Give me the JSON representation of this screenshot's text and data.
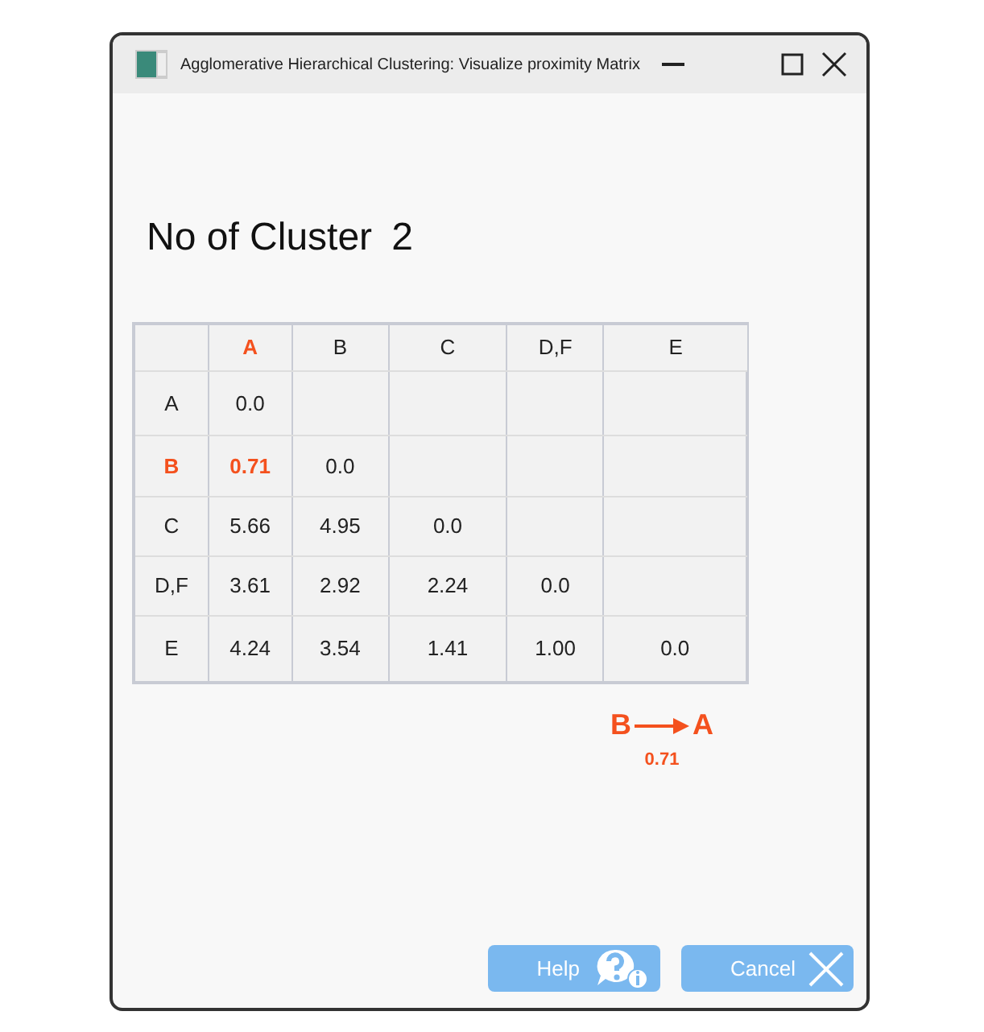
{
  "window": {
    "title": "Agglomerative Hierarchical Clustering: Visualize proximity Matrix"
  },
  "cluster_count": {
    "label": "No of Cluster",
    "value": "2"
  },
  "matrix": {
    "columns": [
      {
        "label": "A",
        "highlighted": true
      },
      {
        "label": "B",
        "highlighted": false
      },
      {
        "label": "C",
        "highlighted": false
      },
      {
        "label": "D,F",
        "highlighted": false
      },
      {
        "label": "E",
        "highlighted": false
      }
    ],
    "rows": [
      {
        "label": "A",
        "highlighted": false,
        "cells": [
          {
            "value": "0.0",
            "highlighted": false
          }
        ]
      },
      {
        "label": "B",
        "highlighted": true,
        "cells": [
          {
            "value": "0.71",
            "highlighted": true
          },
          {
            "value": "0.0",
            "highlighted": false
          }
        ]
      },
      {
        "label": "C",
        "highlighted": false,
        "cells": [
          {
            "value": "5.66",
            "highlighted": false
          },
          {
            "value": "4.95",
            "highlighted": false
          },
          {
            "value": "0.0",
            "highlighted": false
          }
        ]
      },
      {
        "label": "D,F",
        "highlighted": false,
        "cells": [
          {
            "value": "3.61",
            "highlighted": false
          },
          {
            "value": "2.92",
            "highlighted": false
          },
          {
            "value": "2.24",
            "highlighted": false
          },
          {
            "value": "0.0",
            "highlighted": false
          }
        ]
      },
      {
        "label": "E",
        "highlighted": false,
        "cells": [
          {
            "value": "4.24",
            "highlighted": false
          },
          {
            "value": "3.54",
            "highlighted": false
          },
          {
            "value": "1.41",
            "highlighted": false
          },
          {
            "value": "1.00",
            "highlighted": false
          },
          {
            "value": "0.0",
            "highlighted": false
          }
        ]
      }
    ]
  },
  "merge": {
    "from": "B",
    "to": "A",
    "distance": "0.71"
  },
  "buttons": [
    {
      "label": "Help",
      "kind": "help"
    },
    {
      "label": "Cancel",
      "kind": "cancel"
    }
  ]
}
